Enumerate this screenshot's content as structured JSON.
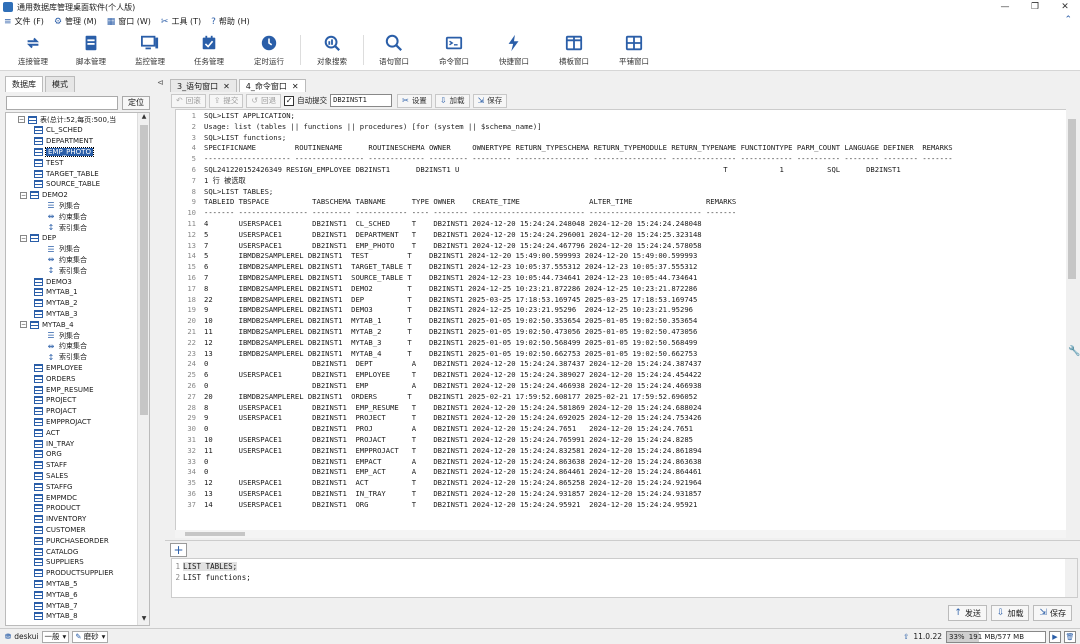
{
  "window": {
    "title": "通用数据库管理桌面软件(个人版)",
    "min": "—",
    "max": "❐",
    "close": "✕"
  },
  "menu": [
    {
      "icon": "≡",
      "label": "文件 (F)"
    },
    {
      "icon": "⚙",
      "label": "管理 (M)"
    },
    {
      "icon": "▦",
      "label": "窗口 (W)"
    },
    {
      "icon": "✂",
      "label": "工具 (T)"
    },
    {
      "icon": "?",
      "label": "帮助 (H)"
    }
  ],
  "toolbar": [
    {
      "label": "连接管理",
      "icon": "connect-icon"
    },
    {
      "label": "脚本管理",
      "icon": "script-icon"
    },
    {
      "label": "监控管理",
      "icon": "monitor-icon"
    },
    {
      "label": "任务管理",
      "icon": "task-icon"
    },
    {
      "label": "定时运行",
      "icon": "clock-icon"
    },
    {
      "label": "对象搜索",
      "icon": "object-search-icon"
    },
    {
      "label": "语句窗口",
      "icon": "search-icon"
    },
    {
      "label": "命令窗口",
      "icon": "command-icon"
    },
    {
      "label": "快捷窗口",
      "icon": "lightning-icon"
    },
    {
      "label": "横板窗口",
      "icon": "horizontal-icon"
    },
    {
      "label": "平铺窗口",
      "icon": "tile-icon"
    }
  ],
  "left": {
    "tabs": [
      "数据库",
      "模式"
    ],
    "locate_label": "定位",
    "tree": [
      {
        "label": "表(总计:52,每页:500,当",
        "type": "root",
        "indent": 0
      },
      {
        "label": "CL_SCHED",
        "type": "table",
        "indent": 1
      },
      {
        "label": "DEPARTMENT",
        "type": "table",
        "indent": 1
      },
      {
        "label": "EMP_PHOTO",
        "type": "table",
        "indent": 1,
        "selected": true
      },
      {
        "label": "TEST",
        "type": "table",
        "indent": 1
      },
      {
        "label": "TARGET_TABLE",
        "type": "table",
        "indent": 1
      },
      {
        "label": "SOURCE_TABLE",
        "type": "table",
        "indent": 1
      },
      {
        "label": "DEMO2",
        "type": "table-exp",
        "indent": 0
      },
      {
        "label": "列集合",
        "type": "columns",
        "indent": 2
      },
      {
        "label": "约束集合",
        "type": "constraints",
        "indent": 2
      },
      {
        "label": "索引集合",
        "type": "indexes",
        "indent": 2
      },
      {
        "label": "DEP",
        "type": "table-exp",
        "indent": 0
      },
      {
        "label": "列集合",
        "type": "columns",
        "indent": 2
      },
      {
        "label": "约束集合",
        "type": "constraints",
        "indent": 2
      },
      {
        "label": "索引集合",
        "type": "indexes",
        "indent": 2
      },
      {
        "label": "DEMO3",
        "type": "table",
        "indent": 1
      },
      {
        "label": "MYTAB_1",
        "type": "table",
        "indent": 1
      },
      {
        "label": "MYTAB_2",
        "type": "table",
        "indent": 1
      },
      {
        "label": "MYTAB_3",
        "type": "table",
        "indent": 1
      },
      {
        "label": "MYTAB_4",
        "type": "table-exp",
        "indent": 0
      },
      {
        "label": "列集合",
        "type": "columns",
        "indent": 2
      },
      {
        "label": "约束集合",
        "type": "constraints",
        "indent": 2
      },
      {
        "label": "索引集合",
        "type": "indexes",
        "indent": 2
      },
      {
        "label": "EMPLOYEE",
        "type": "table",
        "indent": 1
      },
      {
        "label": "ORDERS",
        "type": "table",
        "indent": 1
      },
      {
        "label": "EMP_RESUME",
        "type": "table",
        "indent": 1
      },
      {
        "label": "PROJECT",
        "type": "table",
        "indent": 1
      },
      {
        "label": "PROJACT",
        "type": "table",
        "indent": 1
      },
      {
        "label": "EMPPROJACT",
        "type": "table",
        "indent": 1
      },
      {
        "label": "ACT",
        "type": "table",
        "indent": 1
      },
      {
        "label": "IN_TRAY",
        "type": "table",
        "indent": 1
      },
      {
        "label": "ORG",
        "type": "table",
        "indent": 1
      },
      {
        "label": "STAFF",
        "type": "table",
        "indent": 1
      },
      {
        "label": "SALES",
        "type": "table",
        "indent": 1
      },
      {
        "label": "STAFFG",
        "type": "table",
        "indent": 1
      },
      {
        "label": "EMPMDC",
        "type": "table",
        "indent": 1
      },
      {
        "label": "PRODUCT",
        "type": "table",
        "indent": 1
      },
      {
        "label": "INVENTORY",
        "type": "table",
        "indent": 1
      },
      {
        "label": "CUSTOMER",
        "type": "table",
        "indent": 1
      },
      {
        "label": "PURCHASEORDER",
        "type": "table",
        "indent": 1
      },
      {
        "label": "CATALOG",
        "type": "table",
        "indent": 1
      },
      {
        "label": "SUPPLIERS",
        "type": "table",
        "indent": 1
      },
      {
        "label": "PRODUCTSUPPLIER",
        "type": "table",
        "indent": 1
      },
      {
        "label": "MYTAB_5",
        "type": "table",
        "indent": 1
      },
      {
        "label": "MYTAB_6",
        "type": "table",
        "indent": 1
      },
      {
        "label": "MYTAB_7",
        "type": "table",
        "indent": 1
      },
      {
        "label": "MYTAB_8",
        "type": "table",
        "indent": 1
      }
    ]
  },
  "editor_tabs": [
    {
      "label": "3_语句窗口",
      "active": false
    },
    {
      "label": "4_命令窗口",
      "active": true
    }
  ],
  "editor_toolbar": {
    "rollback": "回滚",
    "commit": "提交",
    "undo": "回退",
    "autocommit": "自动提交",
    "db_value": "DB2INST1",
    "settings": "设置",
    "load": "加载",
    "save": "保存"
  },
  "output_lines": [
    "SQL>LIST APPLICATION;",
    "Usage: list (tables || functions || procedures) [for (system || $schema_name)]",
    "SQL>LIST functions;",
    "SPECIFICNAME         ROUTINENAME      ROUTINESCHEMA OWNER     OWNERTYPE RETURN_TYPESCHEMA RETURN_TYPEMODULE RETURN_TYPENAME FUNCTIONTYPE PARM_COUNT LANGUAGE DEFINER  REMARKS",
    "-------------------- ---------------- ------------- --------- --------- ----------------- ----------------- --------------- ------------ ---------- -------- -------- -------",
    "SQL241220152426349 RESIGN_EMPLOYEE DB2INST1      DB2INST1 U                                                             T            1          SQL      DB2INST1",
    "1 行 被选取",
    "SQL>LIST TABLES;",
    "TABLEID TBSPACE          TABSCHEMA TABNAME      TYPE OWNER    CREATE_TIME                ALTER_TIME                 REMARKS",
    "------- ---------------- --------- ------------ ---- -------- -------------------------- -------------------------- -------",
    "4       USERSPACE1       DB2INST1  CL_SCHED     T    DB2INST1 2024-12-20 15:24:24.248048 2024-12-20 15:24:24.248048",
    "5       USERSPACE1       DB2INST1  DEPARTMENT   T    DB2INST1 2024-12-20 15:24:24.296001 2024-12-20 15:24:25.323148",
    "7       USERSPACE1       DB2INST1  EMP_PHOTO    T    DB2INST1 2024-12-20 15:24:24.467796 2024-12-20 15:24:24.578058",
    "5       IBMDB2SAMPLEREL DB2INST1  TEST         T    DB2INST1 2024-12-20 15:49:00.599993 2024-12-20 15:49:00.599993",
    "6       IBMDB2SAMPLEREL DB2INST1  TARGET_TABLE T    DB2INST1 2024-12-23 10:05:37.555312 2024-12-23 10:05:37.555312",
    "7       IBMDB2SAMPLEREL DB2INST1  SOURCE_TABLE T    DB2INST1 2024-12-23 10:05:44.734641 2024-12-23 10:05:44.734641",
    "8       IBMDB2SAMPLEREL DB2INST1  DEMO2        T    DB2INST1 2024-12-25 10:23:21.872286 2024-12-25 10:23:21.872286",
    "22      IBMDB2SAMPLEREL DB2INST1  DEP          T    DB2INST1 2025-03-25 17:18:53.169745 2025-03-25 17:18:53.169745",
    "9       IBMDB2SAMPLEREL DB2INST1  DEMO3        T    DB2INST1 2024-12-25 10:23:21.95296  2024-12-25 10:23:21.95296",
    "10      IBMDB2SAMPLEREL DB2INST1  MYTAB_1      T    DB2INST1 2025-01-05 19:02:50.353654 2025-01-05 19:02:50.353654",
    "11      IBMDB2SAMPLEREL DB2INST1  MYTAB_2      T    DB2INST1 2025-01-05 19:02:50.473056 2025-01-05 19:02:50.473056",
    "12      IBMDB2SAMPLEREL DB2INST1  MYTAB_3      T    DB2INST1 2025-01-05 19:02:50.568499 2025-01-05 19:02:50.568499",
    "13      IBMDB2SAMPLEREL DB2INST1  MYTAB_4      T    DB2INST1 2025-01-05 19:02:50.662753 2025-01-05 19:02:50.662753",
    "0                        DB2INST1  DEPT         A    DB2INST1 2024-12-20 15:24:24.387437 2024-12-20 15:24:24.387437",
    "6       USERSPACE1       DB2INST1  EMPLOYEE     T    DB2INST1 2024-12-20 15:24:24.389027 2024-12-20 15:24:24.454422",
    "0                        DB2INST1  EMP          A    DB2INST1 2024-12-20 15:24:24.466938 2024-12-20 15:24:24.466938",
    "20      IBMDB2SAMPLEREL DB2INST1  ORDERS       T    DB2INST1 2025-02-21 17:59:52.608177 2025-02-21 17:59:52.696052",
    "8       USERSPACE1       DB2INST1  EMP_RESUME   T    DB2INST1 2024-12-20 15:24:24.581869 2024-12-20 15:24:24.688024",
    "9       USERSPACE1       DB2INST1  PROJECT      T    DB2INST1 2024-12-20 15:24:24.692025 2024-12-20 15:24:24.753426",
    "0                        DB2INST1  PROJ         A    DB2INST1 2024-12-20 15:24:24.7651   2024-12-20 15:24:24.7651",
    "10      USERSPACE1       DB2INST1  PROJACT      T    DB2INST1 2024-12-20 15:24:24.765991 2024-12-20 15:24:24.8285",
    "11      USERSPACE1       DB2INST1  EMPPROJACT   T    DB2INST1 2024-12-20 15:24:24.832581 2024-12-20 15:24:24.861894",
    "0                        DB2INST1  EMPACT       A    DB2INST1 2024-12-20 15:24:24.863638 2024-12-20 15:24:24.863638",
    "0                        DB2INST1  EMP_ACT      A    DB2INST1 2024-12-20 15:24:24.864461 2024-12-20 15:24:24.864461",
    "12      USERSPACE1       DB2INST1  ACT          T    DB2INST1 2024-12-20 15:24:24.865258 2024-12-20 15:24:24.921964",
    "13      USERSPACE1       DB2INST1  IN_TRAY      T    DB2INST1 2024-12-20 15:24:24.931857 2024-12-20 15:24:24.931857",
    "14      USERSPACE1       DB2INST1  ORG          T    DB2INST1 2024-12-20 15:24:24.95921  2024-12-20 15:24:24.95921"
  ],
  "add_button": "+",
  "sql_input": [
    {
      "text": "LIST TABLES;",
      "highlight": true
    },
    {
      "text": "LIST functions;",
      "highlight": false
    }
  ],
  "bottom_buttons": [
    {
      "icon": "↑",
      "label": "发送"
    },
    {
      "icon": "⇩",
      "label": "加载"
    },
    {
      "icon": "⇲",
      "label": "保存"
    }
  ],
  "status": {
    "user": "deskui",
    "level": "一般",
    "theme": "磨砂",
    "version": "11.0.22",
    "mem_percent": "33%",
    "mem_text": "191 MB/577 MB",
    "mem_fill": 0.33
  }
}
